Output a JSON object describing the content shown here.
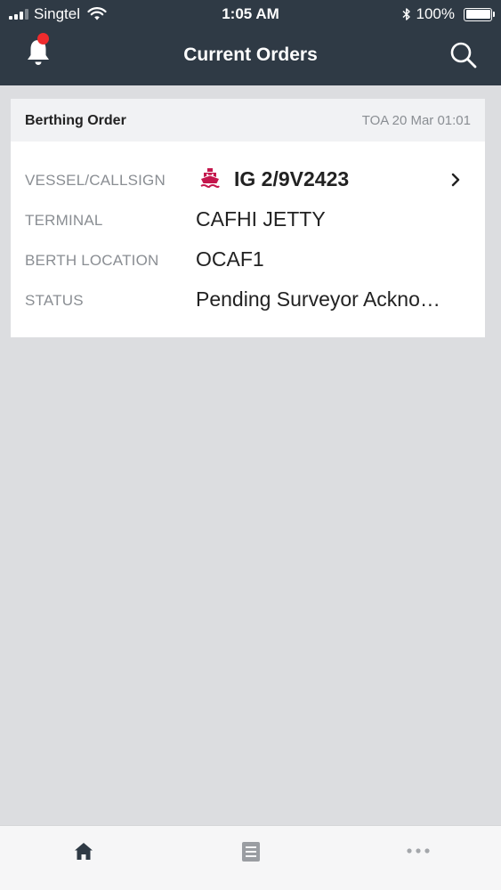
{
  "status_bar": {
    "carrier": "Singtel",
    "time": "1:05 AM",
    "battery": "100%"
  },
  "nav": {
    "title": "Current Orders",
    "left_icon": "bell-icon",
    "right_icon": "search-icon",
    "notification_color": "#ef2b2d"
  },
  "order": {
    "title": "Berthing Order",
    "toa": "TOA 20 Mar 01:01",
    "rows": [
      {
        "label": "VESSEL/CALLSIGN",
        "value": "IG 2/9V2423",
        "icon": "ship-icon"
      },
      {
        "label": "TERMINAL",
        "value": "CAFHI JETTY"
      },
      {
        "label": "BERTH LOCATION",
        "value": "OCAF1"
      },
      {
        "label": "STATUS",
        "value": "Pending Surveyor Ackno…"
      }
    ]
  },
  "tabs": [
    {
      "icon": "home-icon",
      "active": true
    },
    {
      "icon": "document-icon",
      "active": false
    },
    {
      "icon": "more-icon",
      "active": false
    }
  ],
  "colors": {
    "header_bg": "#2f3a45",
    "accent_red": "#c4174d",
    "page_bg": "#dcdde0"
  }
}
